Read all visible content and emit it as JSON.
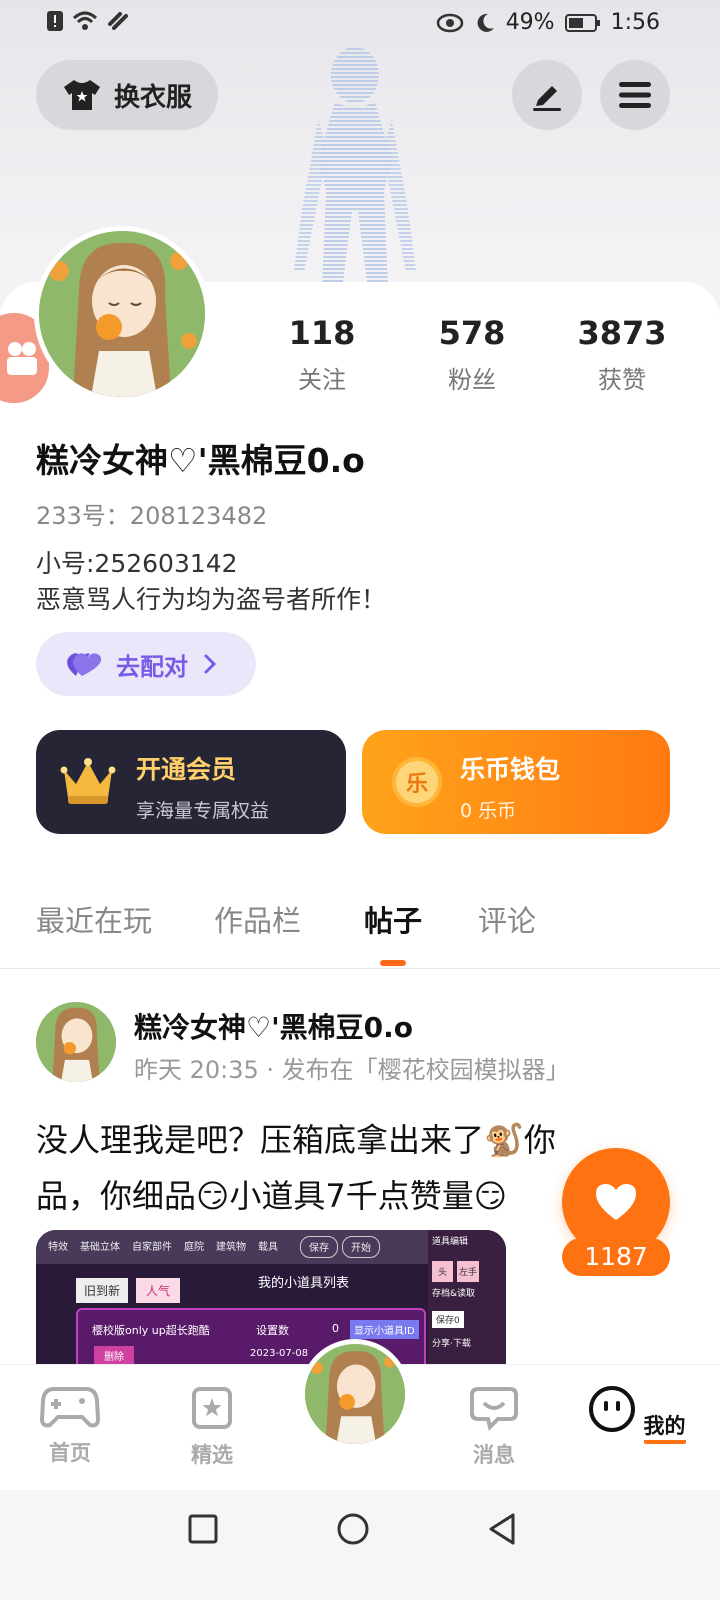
{
  "status_bar": {
    "battery": "49%",
    "time": "1:56"
  },
  "header": {
    "outfit_button": "换衣服"
  },
  "profile": {
    "stats": [
      {
        "value": "118",
        "label": "关注"
      },
      {
        "value": "578",
        "label": "粉丝"
      },
      {
        "value": "3873",
        "label": "获赞"
      }
    ],
    "nickname": "糕冷女神♡'黑棉豆0.o",
    "uid": "233号：208123482",
    "bio_line1": "小号:252603142",
    "bio_line2": "恶意骂人行为均为盗号者所作！",
    "pair_button": "去配对"
  },
  "vip_card": {
    "title": "开通会员",
    "subtitle": "享海量专属权益"
  },
  "wallet_card": {
    "icon_text": "乐",
    "title": "乐币钱包",
    "subtitle": "0 乐币"
  },
  "tabs": [
    "最近在玩",
    "作品栏",
    "帖子",
    "评论"
  ],
  "active_tab": "帖子",
  "post": {
    "author": "糕冷女神♡'黑棉豆0.o",
    "meta": "昨天 20:35 · 发布在「樱花校园模拟器」",
    "text_line1": "没人理我是吧？压箱底拿出来了🐒你",
    "text_line2": "品，你细品😏小道具7千点赞量😏",
    "like_count": "1187",
    "image": {
      "tabs": [
        "特效",
        "基础立体",
        "自家部件",
        "庭院",
        "建筑物",
        "载具"
      ],
      "buttons": [
        "保存",
        "开始"
      ],
      "sort_options": [
        "旧到新",
        "人气"
      ],
      "list_title": "我的小道具列表",
      "panel_title": "道具编辑",
      "panel_items": [
        "头",
        "左手",
        "存档&读取",
        "保存0",
        "分享·下载"
      ],
      "row_name": "樱校版only up超长跑酷",
      "row_label": "设置数",
      "row_count": "0",
      "row_action": "显示小道具ID",
      "row_delete": "删除",
      "row_date": "2023-07-08"
    }
  },
  "bottom_nav": [
    {
      "label": "首页",
      "icon": "gamepad-icon"
    },
    {
      "label": "精选",
      "icon": "star-badge-icon"
    },
    {
      "label": "",
      "icon": "avatar"
    },
    {
      "label": "消息",
      "icon": "chat-bubble-icon"
    },
    {
      "label": "我的",
      "icon": "smiley-icon"
    }
  ],
  "colors": {
    "accent": "#ff7211",
    "vip_bg": "#262535",
    "vip_gold": "#ffcf6b",
    "pair_purple": "#7a5be6"
  }
}
